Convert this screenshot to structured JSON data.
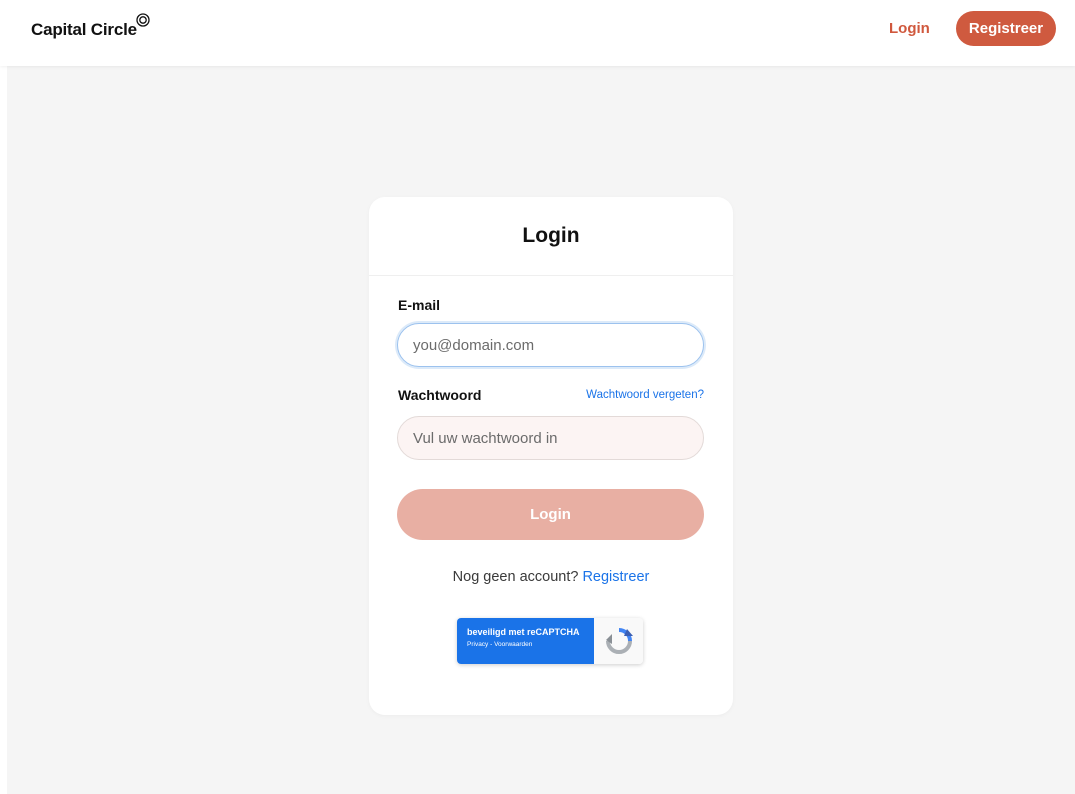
{
  "header": {
    "brand": "Capital Circle",
    "login_label": "Login",
    "register_label": "Registreer"
  },
  "card": {
    "title": "Login",
    "email_label": "E-mail",
    "email_placeholder": "you@domain.com",
    "password_label": "Wachtwoord",
    "forgot_password": "Wachtwoord vergeten?",
    "password_placeholder": "Vul uw wachtwoord in",
    "login_button": "Login",
    "no_account_text": "Nog geen account?",
    "register_link": "Registreer"
  },
  "recaptcha": {
    "title": "beveiligd met reCAPTCHA",
    "links": "Privacy - Voorwaarden"
  },
  "colors": {
    "accent": "#cf5a3f",
    "accent_disabled": "#e8afa3",
    "link": "#1a73e8",
    "page_background": "#f5f5f5"
  },
  "icons": {
    "brand_mark": "concentric-circle-icon",
    "recaptcha_logo": "recaptcha-logo-icon"
  }
}
